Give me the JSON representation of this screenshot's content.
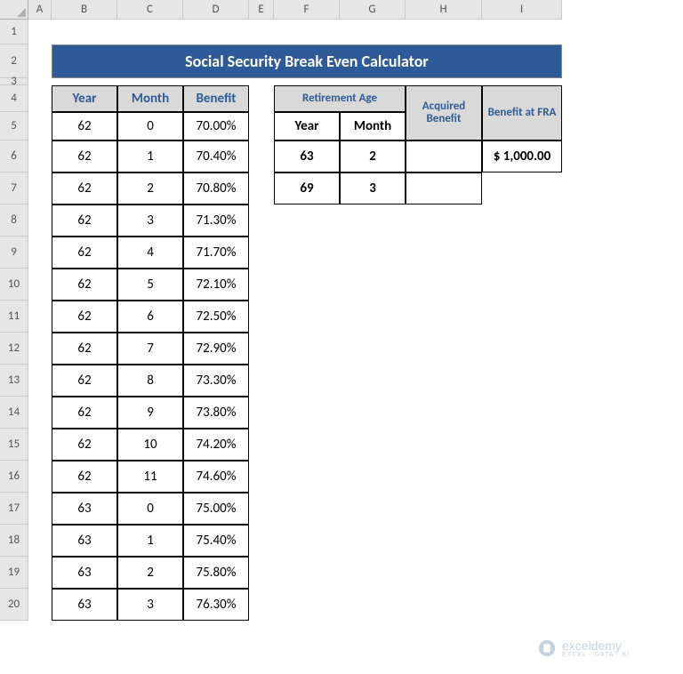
{
  "title": "Social Security Break Even Calculator",
  "columns": [
    "A",
    "B",
    "C",
    "D",
    "E",
    "F",
    "G",
    "H",
    "I"
  ],
  "rows": [
    "1",
    "2",
    "3",
    "4",
    "5",
    "6",
    "7",
    "8",
    "9",
    "10",
    "11",
    "12",
    "13",
    "14",
    "15",
    "16",
    "17",
    "18",
    "19",
    "20"
  ],
  "left_table": {
    "headers": {
      "year": "Year",
      "month": "Month",
      "benefit": "Benefit"
    },
    "rows": [
      {
        "year": "62",
        "month": "0",
        "benefit": "70.00%"
      },
      {
        "year": "62",
        "month": "1",
        "benefit": "70.40%"
      },
      {
        "year": "62",
        "month": "2",
        "benefit": "70.80%"
      },
      {
        "year": "62",
        "month": "3",
        "benefit": "71.30%"
      },
      {
        "year": "62",
        "month": "4",
        "benefit": "71.70%"
      },
      {
        "year": "62",
        "month": "5",
        "benefit": "72.10%"
      },
      {
        "year": "62",
        "month": "6",
        "benefit": "72.50%"
      },
      {
        "year": "62",
        "month": "7",
        "benefit": "72.90%"
      },
      {
        "year": "62",
        "month": "8",
        "benefit": "73.30%"
      },
      {
        "year": "62",
        "month": "9",
        "benefit": "73.80%"
      },
      {
        "year": "62",
        "month": "10",
        "benefit": "74.20%"
      },
      {
        "year": "62",
        "month": "11",
        "benefit": "74.60%"
      },
      {
        "year": "63",
        "month": "0",
        "benefit": "75.00%"
      },
      {
        "year": "63",
        "month": "1",
        "benefit": "75.40%"
      },
      {
        "year": "63",
        "month": "2",
        "benefit": "75.80%"
      },
      {
        "year": "63",
        "month": "3",
        "benefit": "76.30%"
      }
    ]
  },
  "right_table": {
    "headers": {
      "retirement_age": "Retirement Age",
      "year": "Year",
      "month": "Month",
      "acquired_benefit": "Acquired Benefit",
      "benefit_at_fra": "Benefit at FRA"
    },
    "rows": [
      {
        "year": "63",
        "month": "2",
        "acquired": "",
        "fra": "$ 1,000.00"
      },
      {
        "year": "69",
        "month": "3",
        "acquired": ""
      }
    ]
  },
  "watermark": {
    "main": "exceldemy",
    "sub": "EXCEL · DATA · BI"
  }
}
